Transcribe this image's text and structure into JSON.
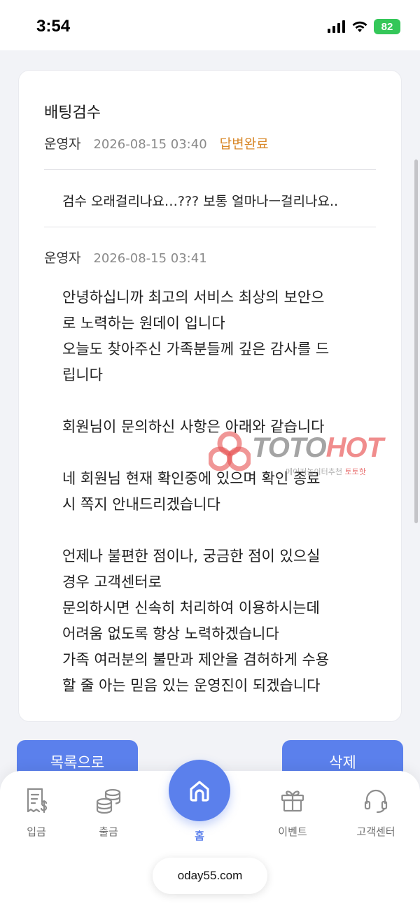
{
  "status_bar": {
    "time": "3:54",
    "battery": "82"
  },
  "post": {
    "title": "배팅검수",
    "author": "운영자",
    "date": "2026-08-15 03:40",
    "status": "답변완료",
    "question": "검수 오래걸리나요…??? 보통 얼마나ㅡ걸리나요.."
  },
  "answer": {
    "author": "운영자",
    "date": "2026-08-15 03:41",
    "lines": [
      "안녕하십니까 최고의 서비스 최상의 보안으",
      "로 노력하는 원데이 입니다",
      "오늘도 찾아주신 가족분들께 깊은 감사를 드",
      "립니다",
      "",
      "회원님이 문의하신 사항은 아래와 같습니다",
      "",
      "네 회원님 현재 확인중에 있으며 확인 종료",
      "시 쪽지 안내드리겠습니다",
      "",
      "언제나 불편한 점이나, 궁금한 점이 있으실",
      "경우 고객센터로",
      "문의하시면 신속히 처리하여 이용하시는데",
      "어려움 없도록 항상 노력하겠습니다",
      "가족 여러분의 불만과 제안을 겸허하게 수용",
      "할 줄 아는 믿음 있는 운영진이 되겠습니다"
    ]
  },
  "watermark": {
    "brand_main": "TOTO",
    "brand_accent": "HOT",
    "sub_text": "메이저놀이터추천",
    "sub_accent": "토토핫"
  },
  "buttons": {
    "list": "목록으로",
    "delete": "삭제"
  },
  "nav": {
    "deposit": "입금",
    "withdraw": "출금",
    "home": "홈",
    "event": "이벤트",
    "support": "고객센터"
  },
  "url": "oday55.com",
  "colors": {
    "accent": "#5b80ec",
    "status": "#d9892b",
    "battery": "#34c759"
  },
  "icons": {
    "deposit": "receipt-dollar-icon",
    "withdraw": "coins-icon",
    "home": "home-icon",
    "event": "gift-icon",
    "support": "headset-icon"
  }
}
